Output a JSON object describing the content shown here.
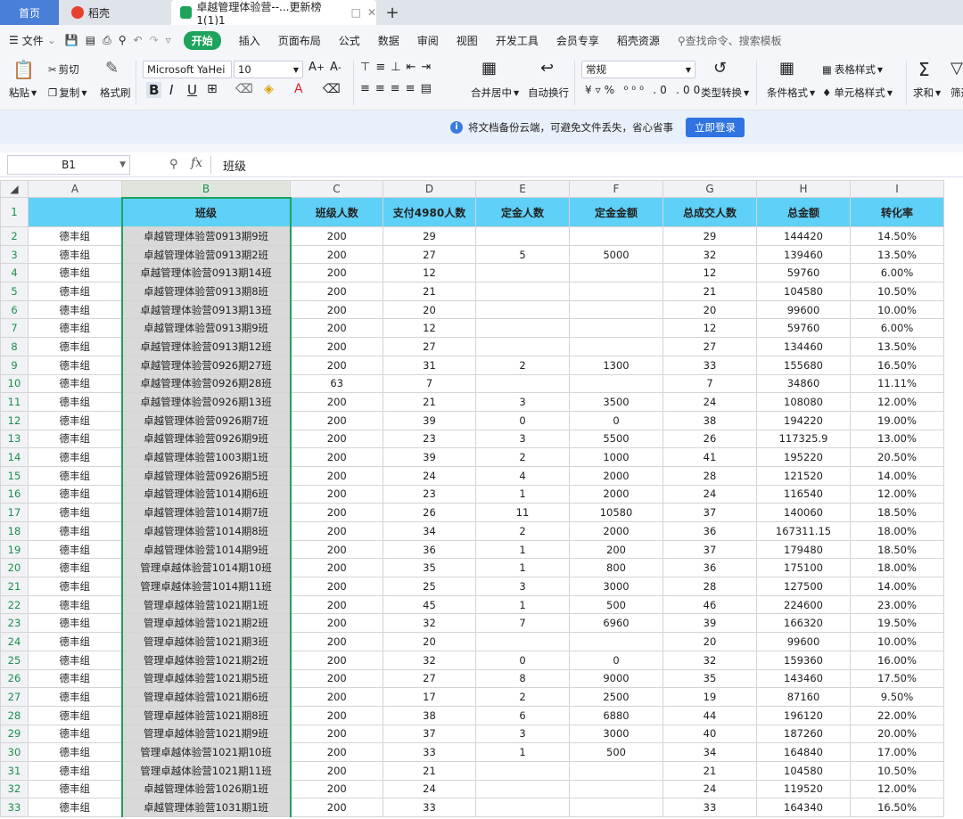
{
  "tabs": {
    "home": "首页",
    "wps": "稻壳",
    "doc": "卓越管理体验营--...更新榜 1(1)1"
  },
  "menu": [
    "文件",
    "开始",
    "插入",
    "页面布局",
    "公式",
    "数据",
    "审阅",
    "视图",
    "开发工具",
    "会员专享",
    "稻壳资源"
  ],
  "search_placeholder": "查找命令、搜索模板",
  "ribbon": {
    "cut": "剪切",
    "paste": "粘贴",
    "copy": "复制",
    "format_painter": "格式刷",
    "font_name": "Microsoft YaHei",
    "font_size": "10",
    "merge_center": "合并居中",
    "auto_wrap": "自动换行",
    "number_format": "常规",
    "type_convert": "类型转换",
    "cond_format": "条件格式",
    "table_style": "表格样式",
    "cell_style": "单元格样式",
    "sum": "求和",
    "filter": "筛选"
  },
  "cloud_notice": "将文档备份云端，可避免文件丢失，省心省事",
  "login_button": "立即登录",
  "cell_ref": "B1",
  "formula_content": "班级",
  "columns": [
    "A",
    "B",
    "C",
    "D",
    "E",
    "F",
    "G",
    "H",
    "I"
  ],
  "header_row": [
    "",
    "班级",
    "班级人数",
    "支付4980人数",
    "定金人数",
    "定金金额",
    "总成交人数",
    "总金额",
    "转化率"
  ],
  "rows": [
    [
      "德丰组",
      "卓越管理体验营0913期9班",
      "200",
      "29",
      "",
      "",
      "29",
      "144420",
      "14.50%"
    ],
    [
      "德丰组",
      "卓越管理体验营0913期2班",
      "200",
      "27",
      "5",
      "5000",
      "32",
      "139460",
      "13.50%"
    ],
    [
      "德丰组",
      "卓越管理体验营0913期14班",
      "200",
      "12",
      "",
      "",
      "12",
      "59760",
      "6.00%"
    ],
    [
      "德丰组",
      "卓越管理体验营0913期8班",
      "200",
      "21",
      "",
      "",
      "21",
      "104580",
      "10.50%"
    ],
    [
      "德丰组",
      "卓越管理体验营0913期13班",
      "200",
      "20",
      "",
      "",
      "20",
      "99600",
      "10.00%"
    ],
    [
      "德丰组",
      "卓越管理体验营0913期9班",
      "200",
      "12",
      "",
      "",
      "12",
      "59760",
      "6.00%"
    ],
    [
      "德丰组",
      "卓越管理体验营0913期12班",
      "200",
      "27",
      "",
      "",
      "27",
      "134460",
      "13.50%"
    ],
    [
      "德丰组",
      "卓越管理体验营0926期27班",
      "200",
      "31",
      "2",
      "1300",
      "33",
      "155680",
      "16.50%"
    ],
    [
      "德丰组",
      "卓越管理体验营0926期28班",
      "63",
      "7",
      "",
      "",
      "7",
      "34860",
      "11.11%"
    ],
    [
      "德丰组",
      "卓越管理体验营0926期13班",
      "200",
      "21",
      "3",
      "3500",
      "24",
      "108080",
      "12.00%"
    ],
    [
      "德丰组",
      "卓越管理体验营0926期7班",
      "200",
      "39",
      "0",
      "0",
      "38",
      "194220",
      "19.00%"
    ],
    [
      "德丰组",
      "卓越管理体验营0926期9班",
      "200",
      "23",
      "3",
      "5500",
      "26",
      "117325.9",
      "13.00%"
    ],
    [
      "德丰组",
      "卓越管理体验营1003期1班",
      "200",
      "39",
      "2",
      "1000",
      "41",
      "195220",
      "20.50%"
    ],
    [
      "德丰组",
      "卓越管理体验营0926期5班",
      "200",
      "24",
      "4",
      "2000",
      "28",
      "121520",
      "14.00%"
    ],
    [
      "德丰组",
      "卓越管理体验营1014期6班",
      "200",
      "23",
      "1",
      "2000",
      "24",
      "116540",
      "12.00%"
    ],
    [
      "德丰组",
      "卓越管理体验营1014期7班",
      "200",
      "26",
      "11",
      "10580",
      "37",
      "140060",
      "18.50%"
    ],
    [
      "德丰组",
      "卓越管理体验营1014期8班",
      "200",
      "34",
      "2",
      "2000",
      "36",
      "167311.15",
      "18.00%"
    ],
    [
      "德丰组",
      "卓越管理体验营1014期9班",
      "200",
      "36",
      "1",
      "200",
      "37",
      "179480",
      "18.50%"
    ],
    [
      "德丰组",
      "管理卓越体验营1014期10班",
      "200",
      "35",
      "1",
      "800",
      "36",
      "175100",
      "18.00%"
    ],
    [
      "德丰组",
      "管理卓越体验营1014期11班",
      "200",
      "25",
      "3",
      "3000",
      "28",
      "127500",
      "14.00%"
    ],
    [
      "德丰组",
      "管理卓越体验营1021期1班",
      "200",
      "45",
      "1",
      "500",
      "46",
      "224600",
      "23.00%"
    ],
    [
      "德丰组",
      "管理卓越体验营1021期2班",
      "200",
      "32",
      "7",
      "6960",
      "39",
      "166320",
      "19.50%"
    ],
    [
      "德丰组",
      "管理卓越体验营1021期3班",
      "200",
      "20",
      "",
      "",
      "20",
      "99600",
      "10.00%"
    ],
    [
      "德丰组",
      "管理卓越体验营1021期2班",
      "200",
      "32",
      "0",
      "0",
      "32",
      "159360",
      "16.00%"
    ],
    [
      "德丰组",
      "管理卓越体验营1021期5班",
      "200",
      "27",
      "8",
      "9000",
      "35",
      "143460",
      "17.50%"
    ],
    [
      "德丰组",
      "管理卓越体验营1021期6班",
      "200",
      "17",
      "2",
      "2500",
      "19",
      "87160",
      "9.50%"
    ],
    [
      "德丰组",
      "管理卓越体验营1021期8班",
      "200",
      "38",
      "6",
      "6880",
      "44",
      "196120",
      "22.00%"
    ],
    [
      "德丰组",
      "管理卓越体验营1021期9班",
      "200",
      "37",
      "3",
      "3000",
      "40",
      "187260",
      "20.00%"
    ],
    [
      "德丰组",
      "管理卓越体验营1021期10班",
      "200",
      "33",
      "1",
      "500",
      "34",
      "164840",
      "17.00%"
    ],
    [
      "德丰组",
      "管理卓越体验营1021期11班",
      "200",
      "21",
      "",
      "",
      "21",
      "104580",
      "10.50%"
    ],
    [
      "德丰组",
      "卓越管理体验营1026期1班",
      "200",
      "24",
      "",
      "",
      "24",
      "119520",
      "12.00%"
    ],
    [
      "德丰组",
      "卓越管理体验营1031期1班",
      "200",
      "33",
      "",
      "",
      "33",
      "164340",
      "16.50%"
    ]
  ],
  "colors": {
    "accent_green": "#1da35b",
    "header_fill": "#5fd0f7",
    "selected_col": "#d9d9d9",
    "tab_blue": "#4a7fd8"
  }
}
